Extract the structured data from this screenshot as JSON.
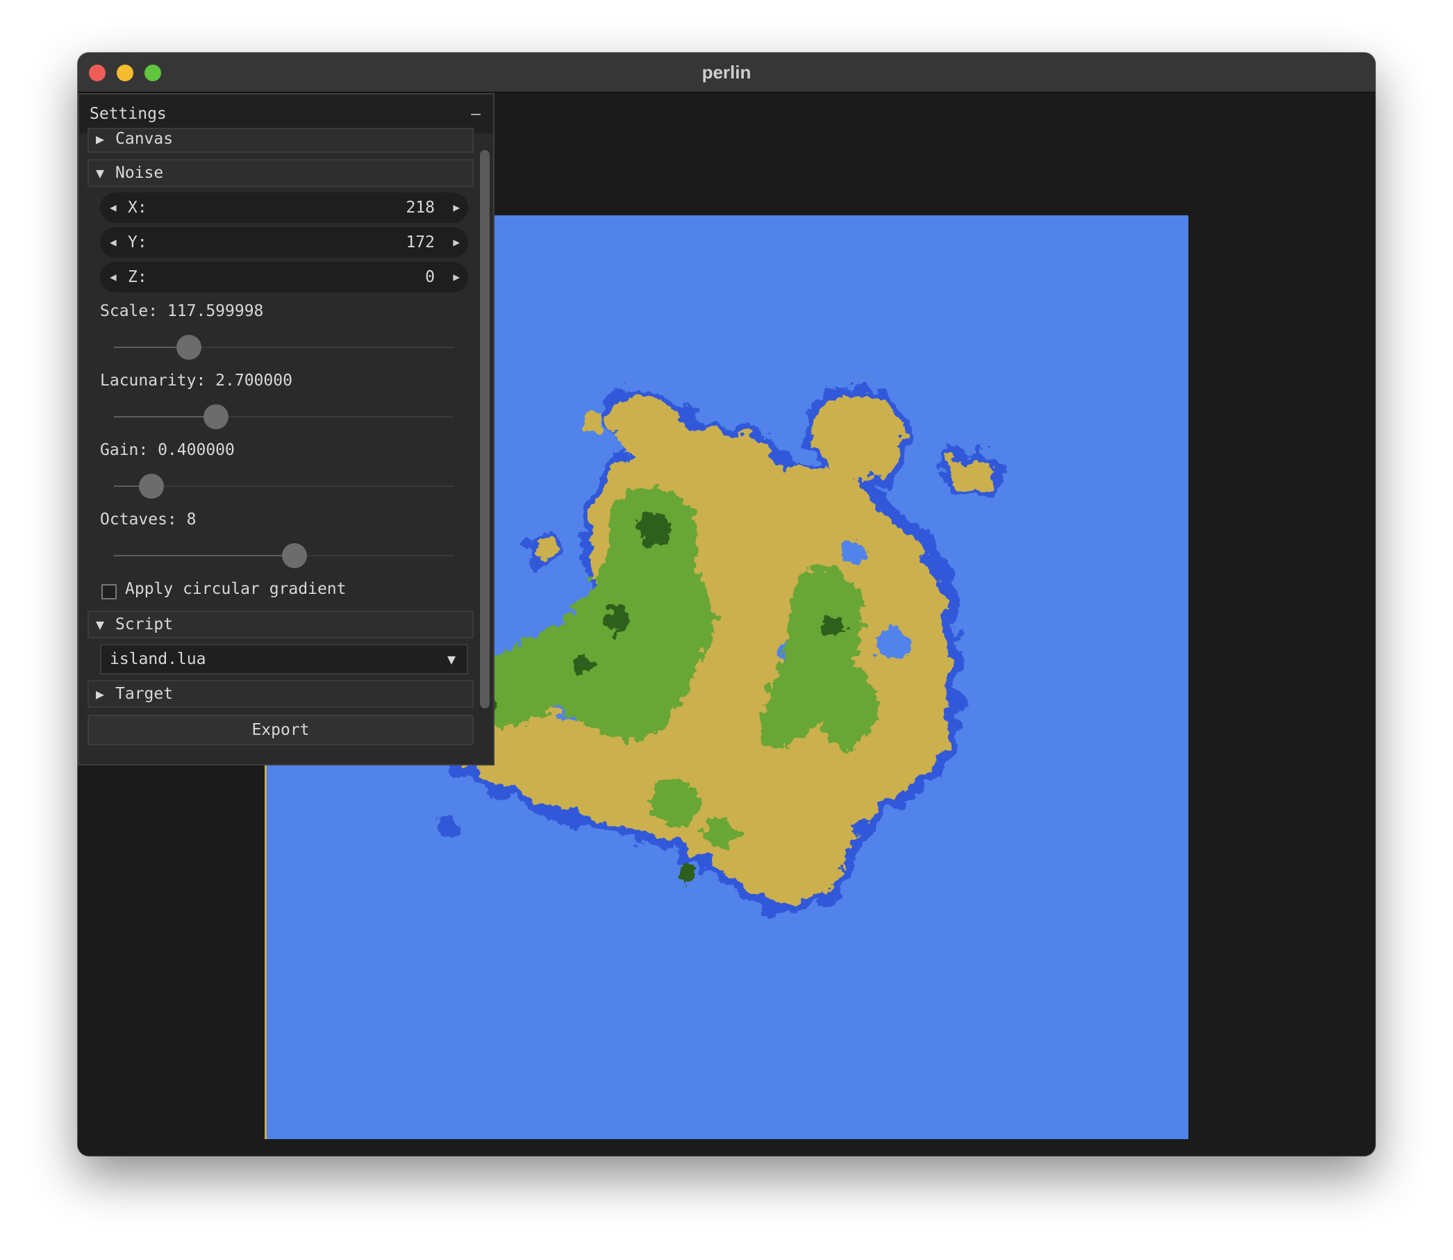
{
  "window": {
    "title": "perlin"
  },
  "settings": {
    "title": "Settings",
    "collapse_label": "–",
    "sections": {
      "canvas": {
        "label": "Canvas",
        "arrow": "▶"
      },
      "noise": {
        "label": "Noise",
        "arrow": "▼"
      },
      "script": {
        "label": "Script",
        "arrow": "▼"
      },
      "target": {
        "label": "Target",
        "arrow": "▶"
      }
    },
    "noise": {
      "x": {
        "label": "X:",
        "value": "218"
      },
      "y": {
        "label": "Y:",
        "value": "172"
      },
      "z": {
        "label": "Z:",
        "value": "0"
      },
      "scale": {
        "label": "Scale: 117.599998",
        "level": 0.22
      },
      "lacunarity": {
        "label": "Lacunarity: 2.700000",
        "level": 0.3
      },
      "gain": {
        "label": "Gain: 0.400000",
        "level": 0.11
      },
      "octaves": {
        "label": "Octaves: 8",
        "level": 0.53
      },
      "circular_gradient": {
        "label": "Apply circular gradient",
        "checked": false
      }
    },
    "script": {
      "selected": "island.lua",
      "chevron": "▼"
    },
    "export_label": "Export"
  },
  "stepper": {
    "decrement": "◀",
    "increment": "▶"
  },
  "map_colors": {
    "water": "#5183ea",
    "shallow": "#3159da",
    "sand": "#cbb04e",
    "grass": "#67a636",
    "forest": "#2f5f1f"
  }
}
